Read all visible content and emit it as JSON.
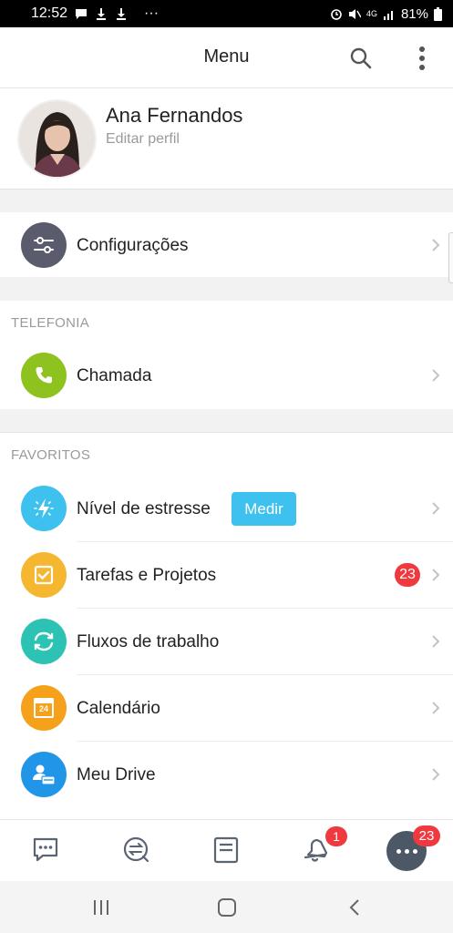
{
  "status_bar": {
    "time": "12:52",
    "more": "···",
    "signal": "4G",
    "battery": "81%"
  },
  "appbar": {
    "title": "Menu"
  },
  "profile": {
    "name": "Ana Fernandos",
    "edit_label": "Editar perfil"
  },
  "settings": {
    "label": "Configurações"
  },
  "telefonia": {
    "header": "TELEFONIA",
    "items": [
      {
        "label": "Chamada"
      }
    ]
  },
  "favoritos": {
    "header": "FAVORITOS",
    "items": [
      {
        "label": "Nível de estresse",
        "action": "Medir"
      },
      {
        "label": "Tarefas e Projetos",
        "badge": "23"
      },
      {
        "label": "Fluxos de trabalho"
      },
      {
        "label": "Calendário",
        "icon_text": "24"
      },
      {
        "label": "Meu Drive"
      }
    ]
  },
  "tabbar": {
    "notifications_badge": "1",
    "more_badge": "23"
  },
  "colors": {
    "settings_icon": "#5b5b6e",
    "call_icon": "#8dc21f",
    "stress_icon": "#3fc1ef",
    "tasks_icon": "#f5b730",
    "flows_icon": "#2cc3b5",
    "calendar_icon": "#f5a11c",
    "drive_icon": "#2196e8",
    "badge": "#f0393f",
    "accent": "#3fc1ef"
  }
}
